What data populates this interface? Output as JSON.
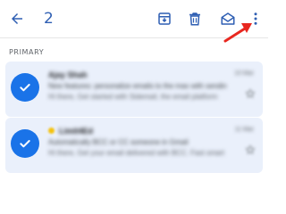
{
  "toolbar": {
    "back_icon": "arrow-left-icon",
    "selected_count": "2",
    "archive_icon": "archive-icon",
    "delete_icon": "trash-icon",
    "mark_read_icon": "envelope-open-icon",
    "more_icon": "more-vert-icon",
    "accent_color": "#2f5fb3",
    "annotation_color": "#e8271f"
  },
  "section": {
    "label": "PRIMARY"
  },
  "emails": [
    {
      "sender": "Ajay Shah",
      "subject": "New features: personalize emails to the max with sendin",
      "snippet": "Hi there, Get started with Sidemail, the email platform",
      "time": "10 Mar"
    },
    {
      "sender": "Limit4Ed",
      "subject": "Automatically BCC or CC someone in Gmail",
      "snippet": "Hi there, Get your email delivered with BCC. Fast smart",
      "time": "11 Mar"
    }
  ]
}
